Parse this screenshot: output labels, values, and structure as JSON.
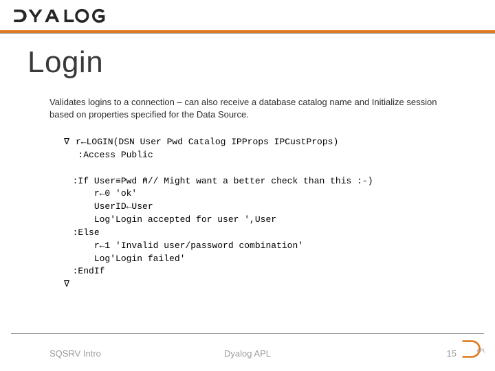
{
  "brand": {
    "name": "DYALOG"
  },
  "title": "Login",
  "description": "Validates logins to a connection – can also receive a database catalog name and Initialize session based on properties specified for the Data Source.",
  "code": {
    "del_open": "∇",
    "header": "r←LOGIN(DSN User Pwd Catalog IPProps IPCustProps)",
    "access": ":Access Public",
    "if_line": ":If User≡Pwd ⍝// Might want a better check than this :-)",
    "ok": "r←0 'ok'",
    "userid": "UserID←User",
    "log_ok": "Log'Login accepted for user ',User",
    "else": ":Else",
    "fail": "r←1 'Invalid user/password combination'",
    "log_fail": "Log'Login failed'",
    "endif": ":EndIf",
    "del_close": "∇"
  },
  "footer": {
    "left": "SQSRV Intro",
    "center": "Dyalog APL",
    "page": "15"
  }
}
